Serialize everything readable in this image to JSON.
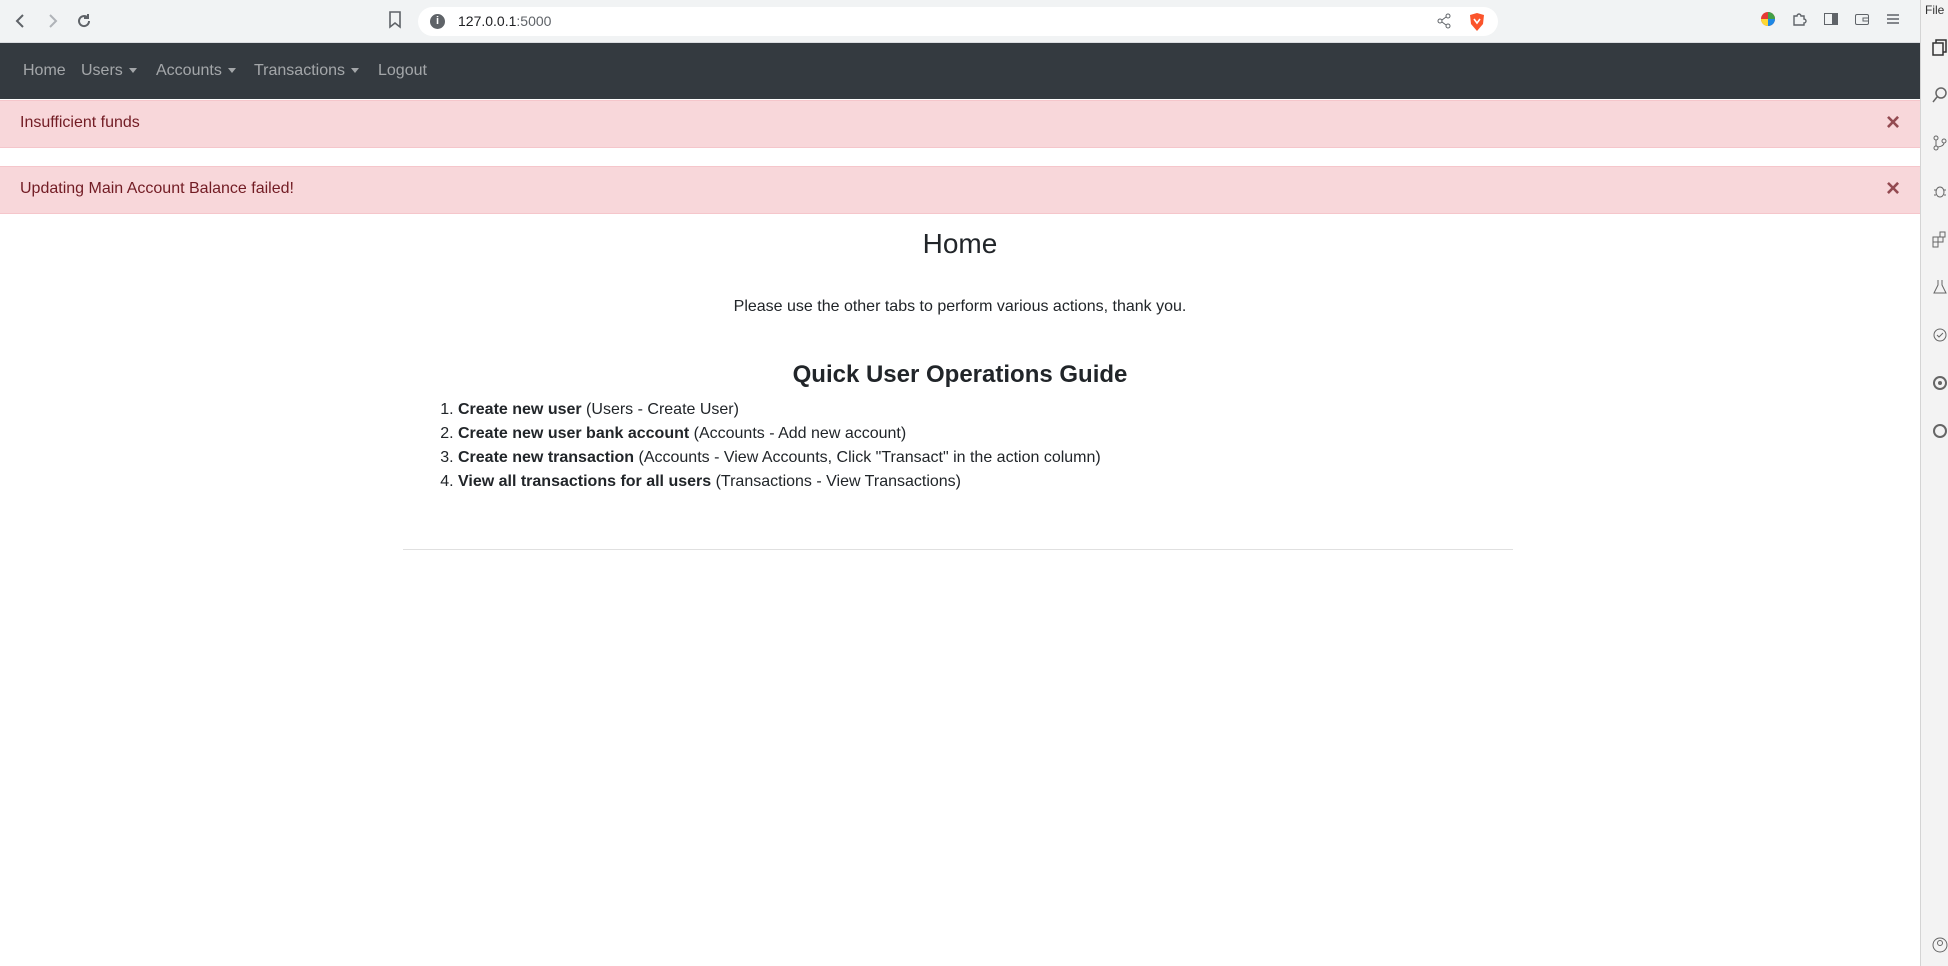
{
  "browser": {
    "url_host": "127.0.0.1",
    "url_port": ":5000",
    "side_label": "File"
  },
  "navbar": {
    "items": [
      {
        "label": "Home"
      },
      {
        "label": "Users"
      },
      {
        "label": "Accounts"
      },
      {
        "label": "Transactions"
      },
      {
        "label": "Logout"
      }
    ]
  },
  "alerts": [
    {
      "message": "Insufficient funds",
      "close": "×"
    },
    {
      "message": "Updating Main Account Balance failed!",
      "close": "×"
    }
  ],
  "page": {
    "title": "Home",
    "intro": "Please use the other tabs to perform various actions, thank you.",
    "guide_title": "Quick User Operations Guide",
    "guide_items": [
      {
        "bold": "Create new user",
        "rest": " (Users - Create User)"
      },
      {
        "bold": "Create new user bank account",
        "rest": " (Accounts - Add new account)"
      },
      {
        "bold": "Create new transaction",
        "rest": " (Accounts - View Accounts, Click \"Transact\" in the action column)"
      },
      {
        "bold": "View all transactions for all users",
        "rest": " (Transactions - View Transactions)"
      }
    ]
  },
  "colors": {
    "navbar_bg": "#343a40",
    "alert_bg": "#f8d7da",
    "alert_text": "#721c24"
  }
}
